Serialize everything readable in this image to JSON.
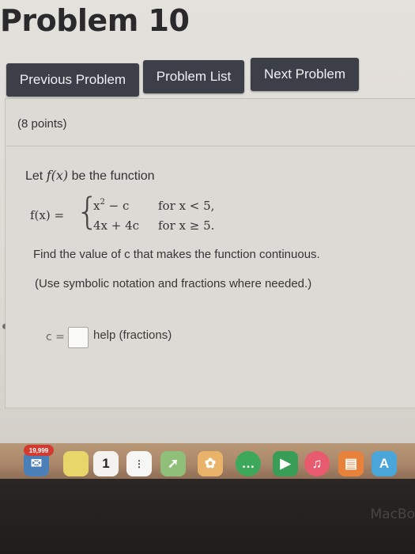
{
  "page": {
    "title": "Problem 10"
  },
  "nav": {
    "previous_label": "Previous Problem",
    "list_label": "Problem List",
    "next_label": "Next Problem"
  },
  "problem": {
    "points": "(8 points)",
    "prompt_prefix": "Let ",
    "prompt_fn": "f(x)",
    "prompt_suffix": " be the function",
    "piecewise": {
      "lhs": "f(x) =",
      "case1_expr_base": "x",
      "case1_expr_exp": "2",
      "case1_expr_rest": " − c",
      "case1_cond": "for x < 5,",
      "case2_expr": "4x + 4c",
      "case2_cond": "for x ≥ 5."
    },
    "instruction": "Find the value of c that makes the function continuous.",
    "hint": "(Use symbolic notation and fractions where needed.)"
  },
  "answer": {
    "label": "c =",
    "value": "",
    "help_link": "help (fractions)"
  },
  "dock": {
    "badge": "19,999",
    "calendar_day": "1",
    "icons": [
      "mail-icon",
      "notes-icon",
      "calendar-icon",
      "reminders-icon",
      "maps-icon",
      "photos-icon",
      "messages-icon",
      "facetime-icon",
      "music-icon",
      "books-icon",
      "app-store-icon"
    ]
  },
  "device": {
    "brand": "MacBo"
  },
  "colors": {
    "button_bg": "#3d3f48",
    "panel_bg": "#dcdad5",
    "bezel": "#1f1c1c"
  }
}
